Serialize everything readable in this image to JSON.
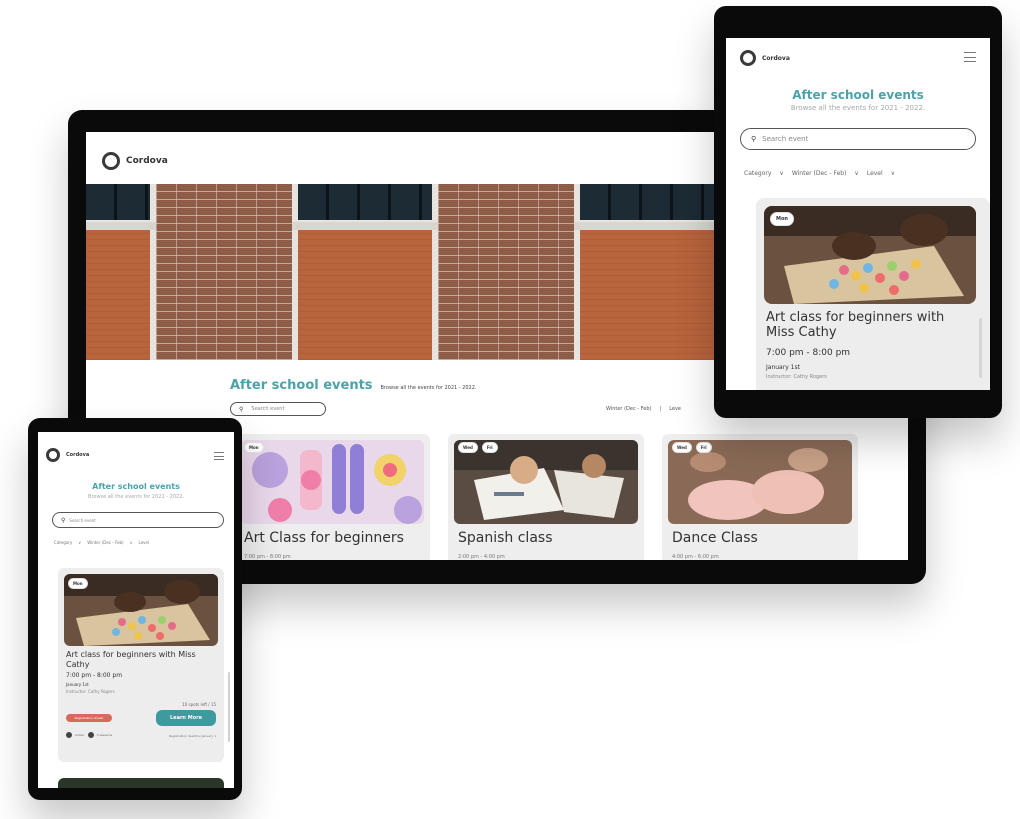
{
  "brand": {
    "name": "Cordova"
  },
  "colors": {
    "accent": "#4aa3a8",
    "badge_red": "#d9695f",
    "button_teal": "#3f9aa0"
  },
  "laptop": {
    "title": "After school events",
    "subtitle": "Browse all the events for 2021 - 2022.",
    "search_placeholder": "Search event",
    "filters": [
      "Winter (Dec - Feb)",
      "|",
      "Leve"
    ],
    "cards": [
      {
        "chips": [
          "Mon"
        ],
        "title": "Art Class for beginners",
        "time": "7:00 pm - 8:00 pm"
      },
      {
        "chips": [
          "Wed",
          "Fri"
        ],
        "title": "Spanish class",
        "time": "2:00 pm - 4:00 pm"
      },
      {
        "chips": [
          "Wed",
          "Fri"
        ],
        "title": "Dance Class",
        "time": "4:00 pm - 6:00 pm"
      }
    ]
  },
  "tablet": {
    "title": "After school events",
    "subtitle": "Browse all the events for 2021 - 2022.",
    "search_placeholder": "Search event",
    "filters": [
      "Category",
      "∨",
      "Winter (Dec - Feb)",
      "∨",
      "Level",
      "∨"
    ],
    "card": {
      "chip": "Mon",
      "title": "Art class for beginners with Miss Cathy",
      "time": "7:00 pm - 8:00 pm",
      "date": "January 1st",
      "instructor": "Instructor: Cathy Rogers"
    }
  },
  "phone": {
    "title": "After school events",
    "subtitle": "Browse all the events for 2021 - 2022.",
    "search_placeholder": "Search event",
    "filters": [
      "Category",
      "∨",
      "Winter (Dec - Feb)",
      "∨",
      "Level"
    ],
    "card": {
      "chip": "Mon",
      "title": "Art class for beginners with Miss Cathy",
      "time": "7:00 pm - 8:00 pm",
      "date": "January 1st",
      "instructor": "Instructor: Cathy Rogers",
      "spots": "10 spots left / 15",
      "status_badge": "Registration closed",
      "cta": "Learn More",
      "meta_1": "Indoor",
      "meta_2": "3 sessions",
      "reg_note": "Registration deadline January 1"
    }
  }
}
